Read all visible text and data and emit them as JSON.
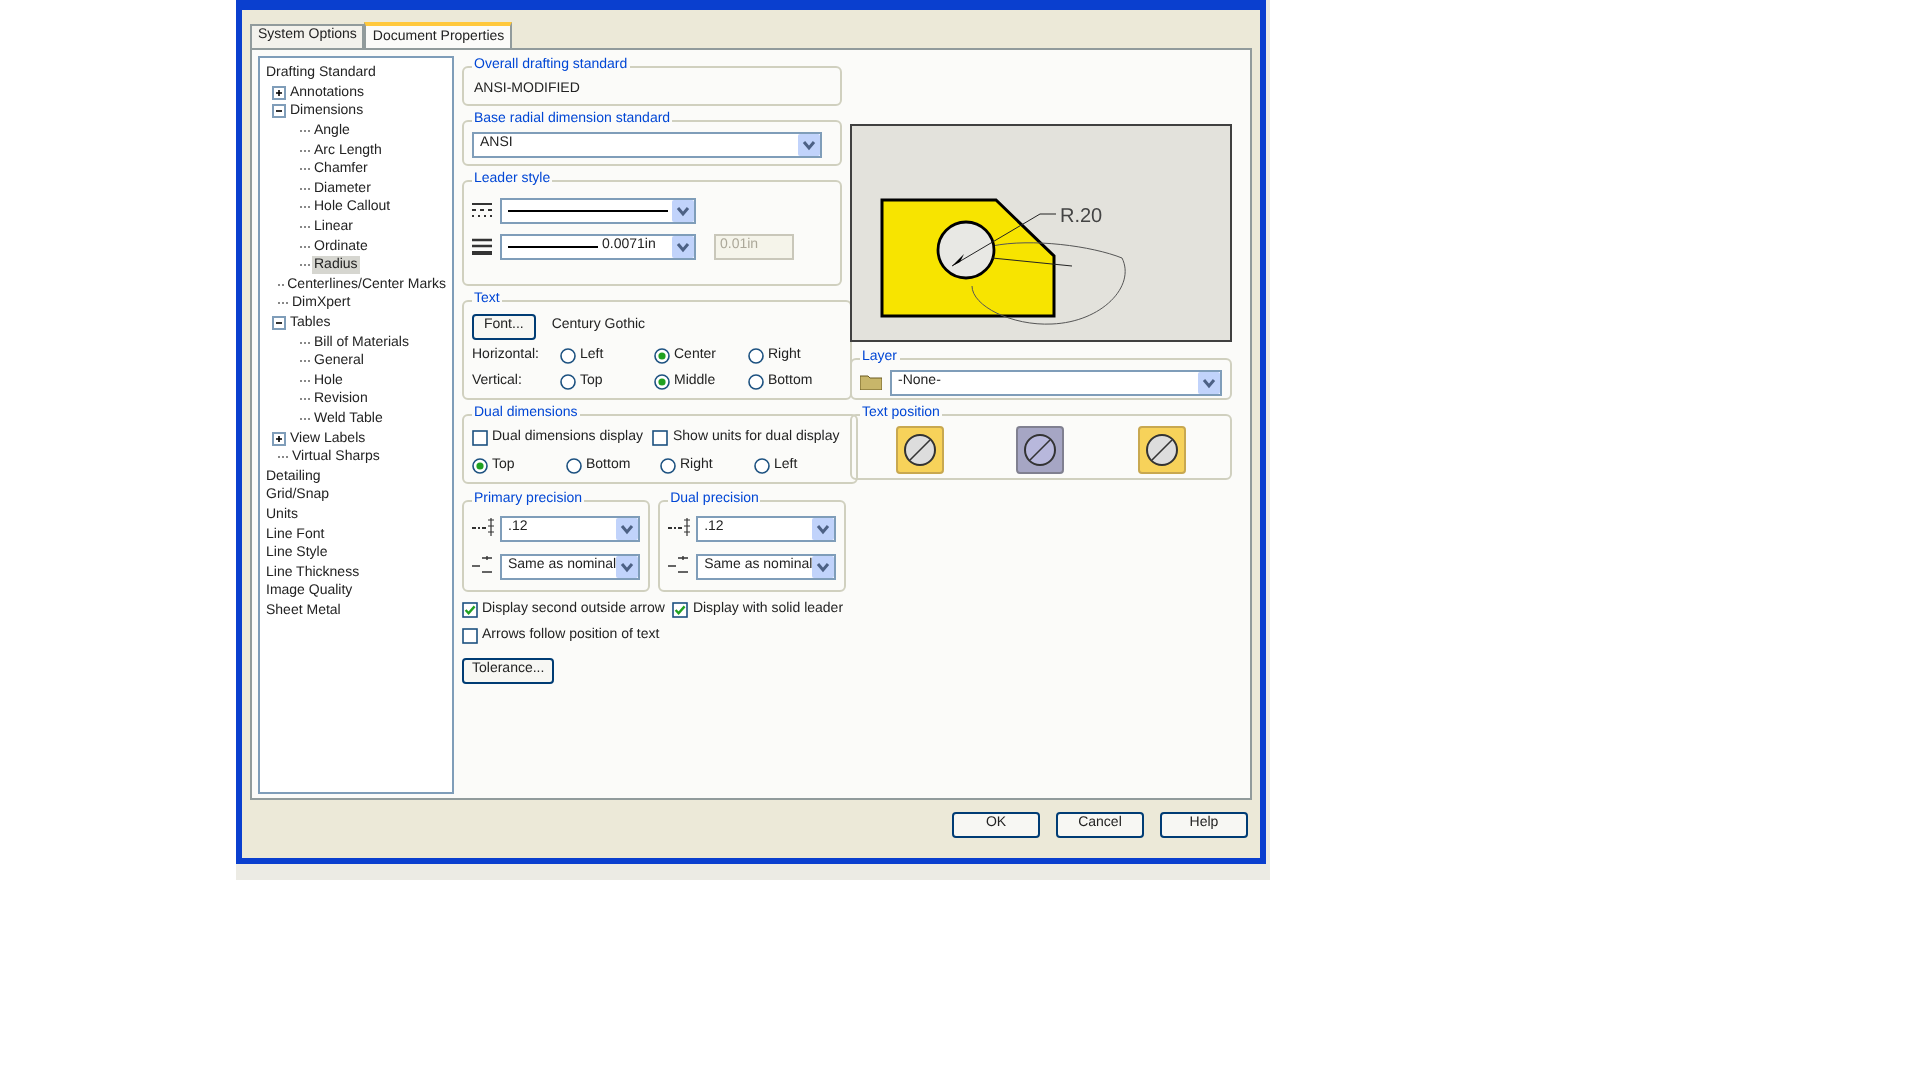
{
  "tabs": [
    {
      "label": "System Options",
      "selected": false
    },
    {
      "label": "Document Properties",
      "selected": true
    }
  ],
  "tree": [
    {
      "label": "Drafting Standard",
      "selected": false,
      "children": [
        {
          "label": "Annotations",
          "selected": false,
          "expanded": false
        },
        {
          "label": "Dimensions",
          "selected": false,
          "expanded": true,
          "children": [
            {
              "label": "Angle",
              "selected": false
            },
            {
              "label": "Arc Length",
              "selected": false
            },
            {
              "label": "Chamfer",
              "selected": false
            },
            {
              "label": "Diameter",
              "selected": false
            },
            {
              "label": "Hole Callout",
              "selected": false
            },
            {
              "label": "Linear",
              "selected": false
            },
            {
              "label": "Ordinate",
              "selected": false
            },
            {
              "label": "Radius",
              "selected": true
            }
          ]
        },
        {
          "label": "Centerlines/Center Marks",
          "selected": false
        },
        {
          "label": "DimXpert",
          "selected": false
        },
        {
          "label": "Tables",
          "selected": false,
          "expanded": true,
          "children": [
            {
              "label": "Bill of Materials",
              "selected": false
            },
            {
              "label": "General",
              "selected": false
            },
            {
              "label": "Hole",
              "selected": false
            },
            {
              "label": "Revision",
              "selected": false
            },
            {
              "label": "Weld Table",
              "selected": false
            }
          ]
        },
        {
          "label": "View Labels",
          "selected": false,
          "expanded": false
        },
        {
          "label": "Virtual Sharps",
          "selected": false
        }
      ]
    },
    {
      "label": "Detailing",
      "selected": false
    },
    {
      "label": "Grid/Snap",
      "selected": false
    },
    {
      "label": "Units",
      "selected": false
    },
    {
      "label": "Line Font",
      "selected": false
    },
    {
      "label": "Line Style",
      "selected": false
    },
    {
      "label": "Line Thickness",
      "selected": false
    },
    {
      "label": "Image Quality",
      "selected": false
    },
    {
      "label": "Sheet Metal",
      "selected": false
    }
  ],
  "overall_standard": {
    "legend": "Overall drafting standard",
    "value": "ANSI-MODIFIED"
  },
  "base_radial": {
    "legend": "Base radial dimension standard",
    "value": "ANSI"
  },
  "leader_style": {
    "legend": "Leader style",
    "thickness": "0.0071in",
    "custom_thickness": "0.01in",
    "custom_disabled": true
  },
  "text": {
    "legend": "Text",
    "font_button": "Font...",
    "font_name": "Century Gothic",
    "rows": [
      {
        "label": "Horizontal:",
        "options": [
          {
            "label": "Left",
            "selected": false
          },
          {
            "label": "Center",
            "selected": true
          },
          {
            "label": "Right",
            "selected": false
          }
        ]
      },
      {
        "label": "Vertical:",
        "options": [
          {
            "label": "Top",
            "selected": false
          },
          {
            "label": "Middle",
            "selected": true
          },
          {
            "label": "Bottom",
            "selected": false
          }
        ]
      }
    ]
  },
  "dual": {
    "legend": "Dual dimensions",
    "checkboxes": [
      {
        "label": "Dual dimensions display",
        "checked": false
      },
      {
        "label": "Show units for dual display",
        "checked": false
      }
    ],
    "positions": [
      {
        "label": "Top",
        "selected": true
      },
      {
        "label": "Bottom",
        "selected": false
      },
      {
        "label": "Right",
        "selected": false
      },
      {
        "label": "Left",
        "selected": false
      }
    ]
  },
  "precision": [
    {
      "legend": "Primary precision",
      "value": ".12",
      "tolerance": "Same as nominal"
    },
    {
      "legend": "Dual precision",
      "value": ".12",
      "tolerance": "Same as nominal"
    }
  ],
  "options": [
    {
      "label": "Display second outside arrow",
      "checked": true
    },
    {
      "label": "Display with solid leader",
      "checked": true
    },
    {
      "label": "Arrows follow position of text",
      "checked": false
    }
  ],
  "tolerance_button": "Tolerance...",
  "preview": {
    "dimension": "R.20"
  },
  "layer": {
    "legend": "Layer",
    "value": "-None-"
  },
  "text_position": {
    "legend": "Text position",
    "options": [
      {
        "selected": false
      },
      {
        "selected": true
      },
      {
        "selected": false
      }
    ]
  },
  "buttons": [
    "OK",
    "Cancel",
    "Help"
  ]
}
